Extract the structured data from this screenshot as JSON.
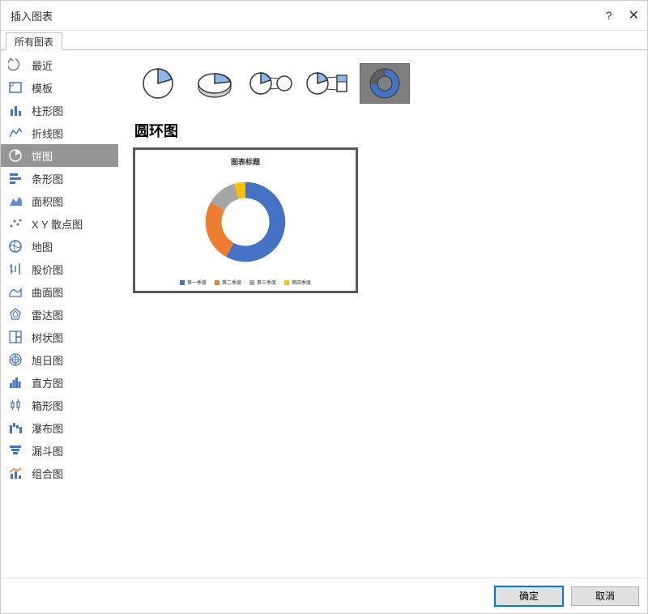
{
  "title": "插入图表",
  "help_label": "?",
  "close_label": "✕",
  "tab": {
    "all": "所有图表"
  },
  "sidebar": {
    "items": [
      {
        "label": "最近",
        "icon": "recent-icon"
      },
      {
        "label": "模板",
        "icon": "template-icon"
      },
      {
        "label": "柱形图",
        "icon": "column-icon"
      },
      {
        "label": "折线图",
        "icon": "line-icon"
      },
      {
        "label": "饼图",
        "icon": "pie-icon"
      },
      {
        "label": "条形图",
        "icon": "bar-icon"
      },
      {
        "label": "面积图",
        "icon": "area-icon"
      },
      {
        "label": "X Y 散点图",
        "icon": "scatter-icon"
      },
      {
        "label": "地图",
        "icon": "map-icon"
      },
      {
        "label": "股价图",
        "icon": "stock-icon"
      },
      {
        "label": "曲面图",
        "icon": "surface-icon"
      },
      {
        "label": "雷达图",
        "icon": "radar-icon"
      },
      {
        "label": "树状图",
        "icon": "treemap-icon"
      },
      {
        "label": "旭日图",
        "icon": "sunburst-icon"
      },
      {
        "label": "直方图",
        "icon": "histogram-icon"
      },
      {
        "label": "箱形图",
        "icon": "box-icon"
      },
      {
        "label": "瀑布图",
        "icon": "waterfall-icon"
      },
      {
        "label": "漏斗图",
        "icon": "funnel-icon"
      },
      {
        "label": "组合图",
        "icon": "combo-icon"
      }
    ],
    "selected_index": 4
  },
  "subtypes": {
    "selected_index": 4,
    "items": [
      "pie",
      "pie-3d",
      "pie-of-pie",
      "bar-of-pie",
      "doughnut"
    ]
  },
  "preview": {
    "heading": "圆环图",
    "chart_title": "图表标题",
    "legend": {
      "q1": "第一季度",
      "q2": "第二季度",
      "q3": "第三季度",
      "q4": "第四季度"
    }
  },
  "footer": {
    "ok": "确定",
    "cancel": "取消"
  },
  "chart_data": {
    "type": "pie",
    "subtype": "doughnut",
    "title": "图表标题",
    "categories": [
      "第一季度",
      "第二季度",
      "第三季度",
      "第四季度"
    ],
    "values": [
      58,
      23,
      10,
      9
    ],
    "colors": {
      "第一季度": "#4472C4",
      "第二季度": "#ED7D31",
      "第三季度": "#A5A5A5",
      "第四季度": "#FFC000"
    }
  }
}
